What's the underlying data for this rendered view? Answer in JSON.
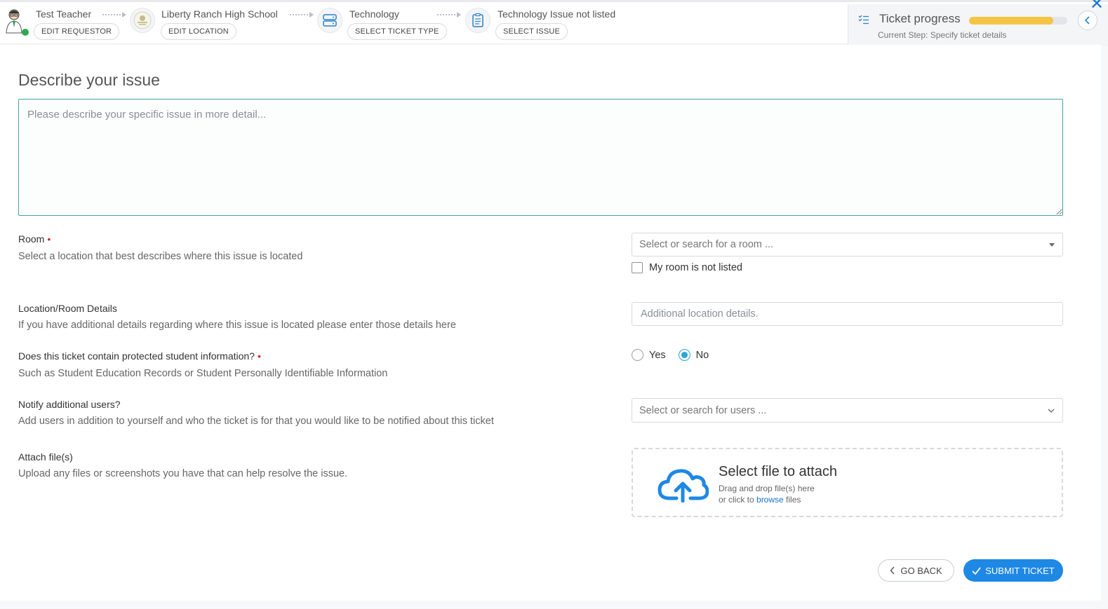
{
  "header": {
    "steps": [
      {
        "title": "Test Teacher",
        "button": "EDIT REQUESTOR"
      },
      {
        "title": "Liberty Ranch High School",
        "button": "EDIT LOCATION"
      },
      {
        "title": "Technology",
        "button": "SELECT TICKET TYPE"
      },
      {
        "title": "Technology Issue not listed",
        "button": "SELECT ISSUE"
      }
    ],
    "progress": {
      "title": "Ticket progress",
      "subtitle": "Current Step:  Specify ticket details",
      "percent": 86
    }
  },
  "form": {
    "heading": "Describe your issue",
    "description_placeholder": "Please describe your specific issue in more detail...",
    "room": {
      "label": "Room",
      "help": "Select a location that best describes where this issue is located",
      "placeholder": "Select or search for a room ...",
      "not_listed_label": "My room is not listed"
    },
    "location_details": {
      "label": "Location/Room Details",
      "help": "If you have additional details regarding where this issue is located please enter those details here",
      "placeholder": "Additional location details."
    },
    "protected_info": {
      "label": "Does this ticket contain protected student information?",
      "help": "Such as Student Education Records or Student Personally Identifiable Information",
      "yes_label": "Yes",
      "no_label": "No",
      "selected": "No"
    },
    "notify": {
      "label": "Notify additional users?",
      "help": "Add users in addition to yourself and who the ticket is for that you would like to be notified about this ticket",
      "placeholder": "Select or search for users ..."
    },
    "attach": {
      "label": "Attach file(s)",
      "help": "Upload any files or screenshots you have that can help resolve the issue.",
      "title": "Select file to attach",
      "line1": "Drag and drop file(s) here",
      "line2_prefix": "or click to ",
      "line2_link": "browse",
      "line2_suffix": " files"
    }
  },
  "actions": {
    "back_label": "GO BACK",
    "submit_label": "SUBMIT TICKET"
  },
  "colors": {
    "accent": "#1e88e5",
    "progress": "#f6c445",
    "focus_border": "#3fa7a0",
    "required": "#d9262c"
  }
}
